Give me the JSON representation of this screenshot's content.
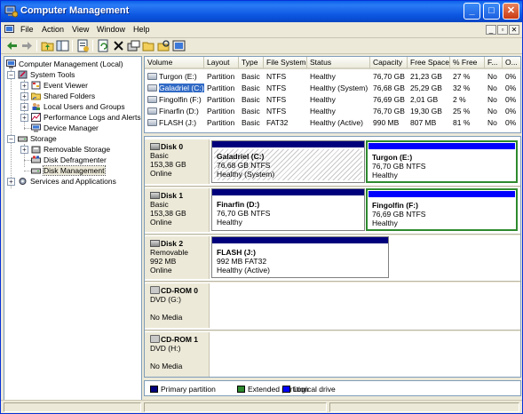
{
  "window": {
    "title": "Computer Management",
    "buttons": {
      "minimize": "_",
      "maximize": "□",
      "close": "✕"
    }
  },
  "menubar": {
    "items": [
      "File",
      "Action",
      "View",
      "Window",
      "Help"
    ],
    "mdi": [
      "_",
      "▫",
      "✕"
    ]
  },
  "toolbar": {
    "icons": [
      "back-arrow-icon",
      "forward-arrow-icon",
      "up-folder-icon",
      "show-hide-tree-icon",
      "properties-icon",
      "help-icon",
      "refresh-icon",
      "delete-icon",
      "disk-properties-icon",
      "open-folder-icon",
      "explore-icon",
      "drive-help-icon"
    ]
  },
  "tree": {
    "root": "Computer Management (Local)",
    "system_tools": "System Tools",
    "event_viewer": "Event Viewer",
    "shared_folders": "Shared Folders",
    "local_users": "Local Users and Groups",
    "perf_logs": "Performance Logs and Alerts",
    "device_manager": "Device Manager",
    "storage": "Storage",
    "removable_storage": "Removable Storage",
    "defrag": "Disk Defragmenter",
    "disk_mgmt": "Disk Management",
    "services": "Services and Applications"
  },
  "volume_list": {
    "columns": [
      "Volume",
      "Layout",
      "Type",
      "File System",
      "Status",
      "Capacity",
      "Free Space",
      "% Free",
      "F...",
      "O..."
    ],
    "rows": [
      [
        "Turgon (E:)",
        "Partition",
        "Basic",
        "NTFS",
        "Healthy",
        "76,70 GB",
        "21,23 GB",
        "27 %",
        "No",
        "0%"
      ],
      [
        "Galadriel (C:)",
        "Partition",
        "Basic",
        "NTFS",
        "Healthy (System)",
        "76,68 GB",
        "25,29 GB",
        "32 %",
        "No",
        "0%"
      ],
      [
        "Fingolfin (F:)",
        "Partition",
        "Basic",
        "NTFS",
        "Healthy",
        "76,69 GB",
        "2,01 GB",
        "2 %",
        "No",
        "0%"
      ],
      [
        "Finarfin (D:)",
        "Partition",
        "Basic",
        "NTFS",
        "Healthy",
        "76,70 GB",
        "19,30 GB",
        "25 %",
        "No",
        "0%"
      ],
      [
        "FLASH (J:)",
        "Partition",
        "Basic",
        "FAT32",
        "Healthy (Active)",
        "990 MB",
        "807 MB",
        "81 %",
        "No",
        "0%"
      ]
    ],
    "selected_row": 1
  },
  "disks": {
    "disk0": {
      "name": "Disk 0",
      "type": "Basic",
      "size": "153,38 GB",
      "state": "Online",
      "p1": {
        "name": "Galadriel  (C:)",
        "size": "76,68 GB NTFS",
        "status": "Healthy (System)"
      },
      "p2": {
        "name": "Turgon  (E:)",
        "size": "76,70 GB NTFS",
        "status": "Healthy"
      }
    },
    "disk1": {
      "name": "Disk 1",
      "type": "Basic",
      "size": "153,38 GB",
      "state": "Online",
      "p1": {
        "name": "Finarfin  (D:)",
        "size": "76,70 GB NTFS",
        "status": "Healthy"
      },
      "p2": {
        "name": "Fingolfin  (F:)",
        "size": "76,69 GB NTFS",
        "status": "Healthy"
      }
    },
    "disk2": {
      "name": "Disk 2",
      "type": "Removable",
      "size": "992 MB",
      "state": "Online",
      "p1": {
        "name": "FLASH  (J:)",
        "size": "992 MB FAT32",
        "status": "Healthy (Active)"
      }
    },
    "cdrom0": {
      "name": "CD-ROM 0",
      "type": "DVD (G:)",
      "media": "No Media"
    },
    "cdrom1": {
      "name": "CD-ROM 1",
      "type": "DVD (H:)",
      "media": "No Media"
    }
  },
  "legend": {
    "primary": "Primary partition",
    "extended": "Extended partition",
    "logical": "Logical drive"
  },
  "colors": {
    "primary": "#00007d",
    "extended": "#2e8a2e",
    "logical": "#0000ff",
    "selection": "#316ac5",
    "titlebar": "#0a5fe8"
  }
}
